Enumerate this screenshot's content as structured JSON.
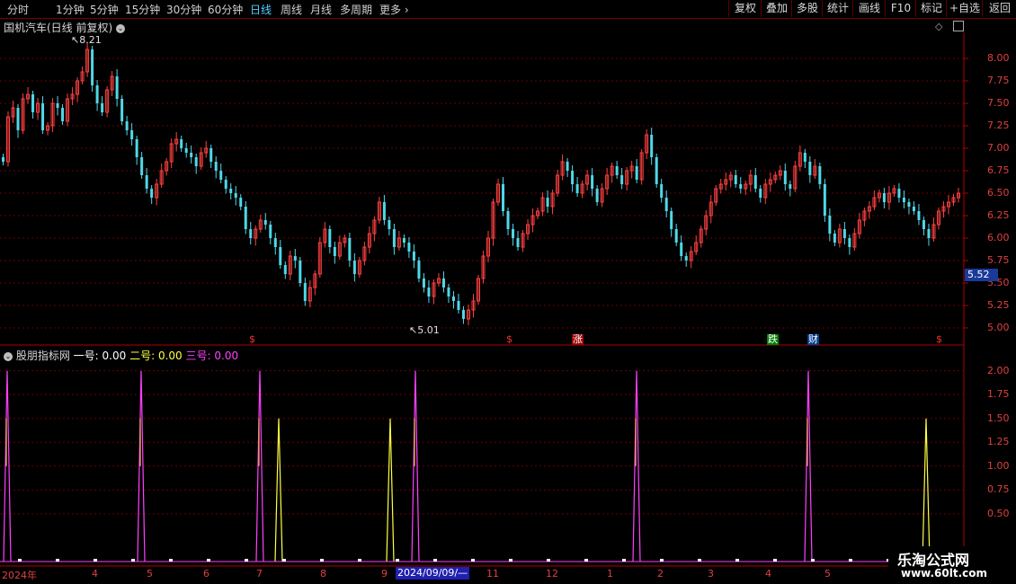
{
  "toolbar": {
    "periods": [
      "分时",
      "1分钟",
      "5分钟",
      "15分钟",
      "30分钟",
      "60分钟",
      "日线",
      "周线",
      "月线",
      "多周期",
      "更多"
    ],
    "active_period": "日线",
    "right_buttons": [
      "复权",
      "叠加",
      "多股",
      "统计",
      "画线",
      "F10",
      "标记",
      "+自选",
      "返回"
    ]
  },
  "main_chart": {
    "title": "国机汽车(日线 前复权)",
    "high_label": "8.21",
    "low_label": "5.01",
    "current_price": "5.52",
    "y_ticks": [
      "8.00",
      "7.75",
      "7.50",
      "7.25",
      "7.00",
      "6.75",
      "6.50",
      "6.25",
      "6.00",
      "5.75",
      "5.50",
      "5.25",
      "5.00"
    ],
    "event_tags": [
      {
        "text": "$",
        "color": "#ff3030"
      },
      {
        "text": "$",
        "color": "#ff3030"
      },
      {
        "text": "涨",
        "color": "#ffffff",
        "bg": "#a00000"
      },
      {
        "text": "跌",
        "color": "#ffffff",
        "bg": "#008000"
      },
      {
        "text": "财",
        "color": "#ffffff",
        "bg": "#004090"
      },
      {
        "text": "$",
        "color": "#ff3030"
      }
    ],
    "colors": {
      "up": "#ff4040",
      "down": "#4fd8e8",
      "grid": "#6a0000",
      "axis": "#b00000"
    }
  },
  "indicator": {
    "name": "股朋指标网",
    "lines": [
      {
        "label": "一号:",
        "value": "0.00",
        "color": "#ffffff"
      },
      {
        "label": "二号:",
        "value": "0.00",
        "color": "#ffff40"
      },
      {
        "label": "三号:",
        "value": "0.00",
        "color": "#ff40ff"
      }
    ],
    "y_ticks": [
      "2.00",
      "1.75",
      "1.50",
      "1.25",
      "1.00",
      "0.75",
      "0.50"
    ]
  },
  "x_axis": {
    "labels": [
      "2024年",
      "4",
      "5",
      "6",
      "7",
      "8",
      "9",
      "2024/09/09/—",
      "11",
      "12",
      "1",
      "2",
      "3",
      "4",
      "5"
    ],
    "cursor_label": "2024/09/09/—"
  },
  "brand": {
    "name": "乐淘公式网",
    "url": "www.60lt.com"
  },
  "chart_data": {
    "type": "candlestick",
    "title": "国机汽车(日线 前复权)",
    "ylim": [
      4.95,
      8.25
    ],
    "annotations": {
      "high": 8.21,
      "low": 5.01,
      "last": 5.52
    },
    "close": [
      6.85,
      7.35,
      7.45,
      7.2,
      7.55,
      7.6,
      7.4,
      7.5,
      7.2,
      7.25,
      7.5,
      7.45,
      7.3,
      7.55,
      7.6,
      7.75,
      7.85,
      8.1,
      7.7,
      7.5,
      7.4,
      7.65,
      7.8,
      7.55,
      7.3,
      7.2,
      7.1,
      6.9,
      6.7,
      6.55,
      6.45,
      6.6,
      6.75,
      6.85,
      7.05,
      7.1,
      7.0,
      6.95,
      6.9,
      6.8,
      6.95,
      7.0,
      6.85,
      6.75,
      6.65,
      6.55,
      6.5,
      6.45,
      6.35,
      6.1,
      6.0,
      6.1,
      6.2,
      6.15,
      6.0,
      5.9,
      5.7,
      5.6,
      5.8,
      5.75,
      5.5,
      5.3,
      5.45,
      5.6,
      5.95,
      6.1,
      5.9,
      5.8,
      5.95,
      6.0,
      5.75,
      5.6,
      5.75,
      5.9,
      6.05,
      6.2,
      6.4,
      6.2,
      6.1,
      5.9,
      6.0,
      5.95,
      5.85,
      5.75,
      5.55,
      5.45,
      5.35,
      5.5,
      5.55,
      5.45,
      5.35,
      5.3,
      5.2,
      5.1,
      5.2,
      5.3,
      5.55,
      5.8,
      6.0,
      6.4,
      6.6,
      6.3,
      6.1,
      6.0,
      5.9,
      6.05,
      6.15,
      6.25,
      6.3,
      6.45,
      6.35,
      6.5,
      6.7,
      6.85,
      6.75,
      6.6,
      6.5,
      6.6,
      6.7,
      6.55,
      6.4,
      6.55,
      6.7,
      6.8,
      6.7,
      6.6,
      6.75,
      6.8,
      6.65,
      6.95,
      7.15,
      6.9,
      6.6,
      6.45,
      6.3,
      6.1,
      5.95,
      5.8,
      5.75,
      5.85,
      5.95,
      6.1,
      6.25,
      6.4,
      6.55,
      6.6,
      6.65,
      6.7,
      6.6,
      6.55,
      6.6,
      6.7,
      6.55,
      6.45,
      6.6,
      6.65,
      6.7,
      6.75,
      6.6,
      6.55,
      6.8,
      6.95,
      6.85,
      6.7,
      6.8,
      6.6,
      6.25,
      6.05,
      5.95,
      6.1,
      6.0,
      5.9,
      6.05,
      6.2,
      6.3,
      6.35,
      6.45,
      6.5,
      6.4,
      6.5,
      6.55,
      6.45,
      6.4,
      6.35,
      6.3,
      6.2,
      6.1,
      6.0,
      6.15,
      6.3,
      6.35,
      6.4,
      6.45,
      6.5
    ]
  }
}
